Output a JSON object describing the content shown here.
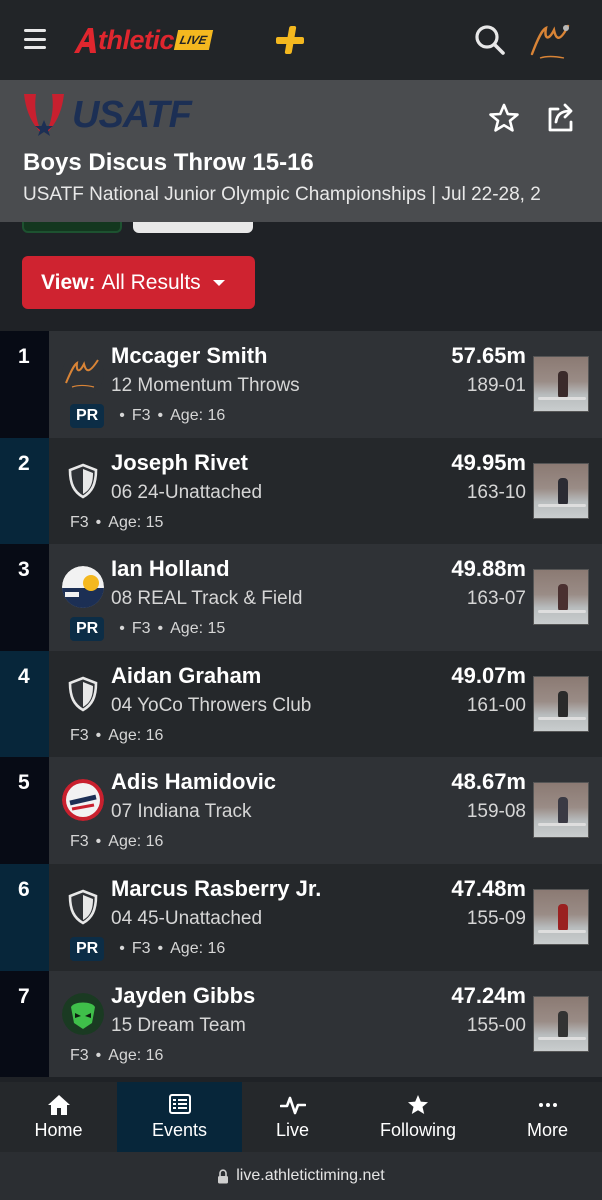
{
  "header": {
    "brand": "thletic",
    "brand_live": "LIVE"
  },
  "event": {
    "org": "USATF",
    "title": "Boys Discus Throw 15-16",
    "subtitle": "USATF National Junior Olympic Championships | Jul 22-28, 2"
  },
  "filter": {
    "view_label": "View:",
    "view_value": "All Results"
  },
  "results": [
    {
      "place": "1",
      "name": "Mccager Smith",
      "team": "12 Momentum Throws",
      "pr": true,
      "pr_label": "PR",
      "flight": "F3",
      "age": "Age: 16",
      "mark": "57.65m",
      "imperial": "189-01"
    },
    {
      "place": "2",
      "name": "Joseph Rivet",
      "team": "06 24-Unattached",
      "pr": false,
      "pr_label": "",
      "flight": "F3",
      "age": "Age: 15",
      "mark": "49.95m",
      "imperial": "163-10"
    },
    {
      "place": "3",
      "name": "Ian Holland",
      "team": "08 REAL Track & Field",
      "pr": true,
      "pr_label": "PR",
      "flight": "F3",
      "age": "Age: 15",
      "mark": "49.88m",
      "imperial": "163-07"
    },
    {
      "place": "4",
      "name": "Aidan Graham",
      "team": "04 YoCo Throwers Club",
      "pr": false,
      "pr_label": "",
      "flight": "F3",
      "age": "Age: 16",
      "mark": "49.07m",
      "imperial": "161-00"
    },
    {
      "place": "5",
      "name": "Adis Hamidovic",
      "team": "07 Indiana Track",
      "pr": false,
      "pr_label": "",
      "flight": "F3",
      "age": "Age: 16",
      "mark": "48.67m",
      "imperial": "159-08"
    },
    {
      "place": "6",
      "name": "Marcus Rasberry Jr.",
      "team": "04 45-Unattached",
      "pr": true,
      "pr_label": "PR",
      "flight": "F3",
      "age": "Age: 16",
      "mark": "47.48m",
      "imperial": "155-09"
    },
    {
      "place": "7",
      "name": "Jayden Gibbs",
      "team": "15 Dream Team",
      "pr": false,
      "pr_label": "",
      "flight": "F3",
      "age": "Age: 16",
      "mark": "47.24m",
      "imperial": "155-00"
    }
  ],
  "nav": {
    "home": "Home",
    "events": "Events",
    "live": "Live",
    "following": "Following",
    "more": "More"
  },
  "url": "live.athletictiming.net",
  "colors": {
    "accent_red": "#cf2330",
    "brand_gold": "#f4b81f",
    "row_dark": "#070b15",
    "row_blue": "#07263a",
    "row_body": "#2f3236"
  },
  "icons": {
    "menu": "hamburger-icon",
    "search": "search-icon",
    "favorite": "star-icon",
    "share": "share-icon",
    "home": "home-icon",
    "events": "list-icon",
    "live": "pulse-icon",
    "following": "star-filled-icon",
    "more": "ellipsis-icon",
    "team_default": "shield-icon"
  }
}
